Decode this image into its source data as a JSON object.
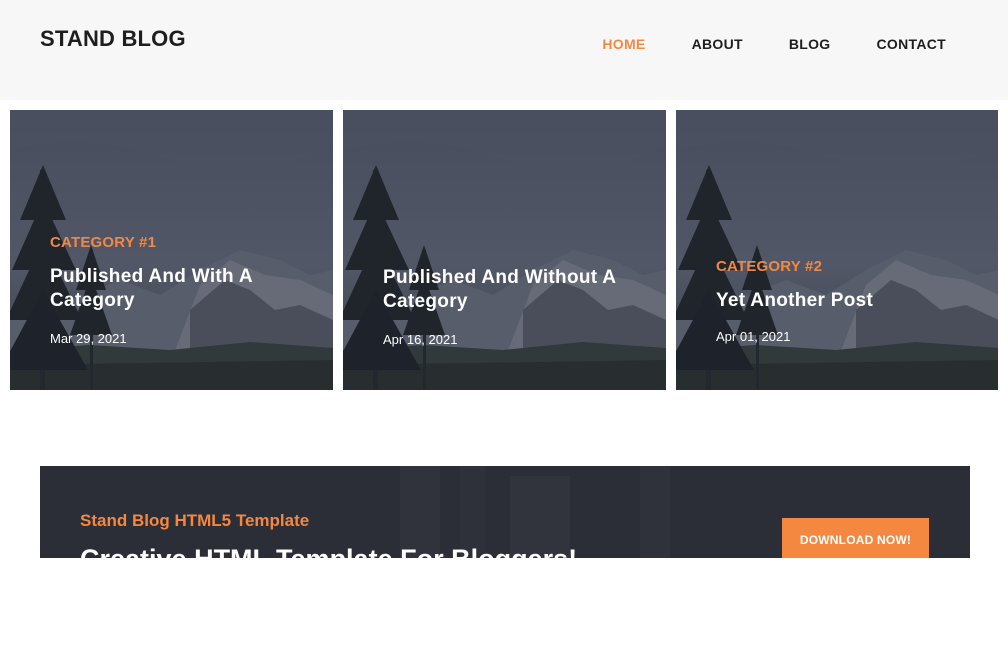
{
  "header": {
    "logo": "STAND BLOG",
    "nav": [
      {
        "label": "HOME",
        "active": true
      },
      {
        "label": "ABOUT",
        "active": false
      },
      {
        "label": "BLOG",
        "active": false
      },
      {
        "label": "CONTACT",
        "active": false
      }
    ]
  },
  "banners": [
    {
      "category": "CATEGORY #1",
      "title": "Published And With A Category",
      "date": "Mar 29, 2021"
    },
    {
      "category": "",
      "title": "Published And Without A Category",
      "date": "Apr 16, 2021"
    },
    {
      "category": "CATEGORY #2",
      "title": "Yet Another Post",
      "date": "Apr 01, 2021"
    }
  ],
  "cta": {
    "subtitle": "Stand Blog HTML5 Template",
    "title": "Creative HTML Template For Bloggers!",
    "button_label": "DOWNLOAD NOW!"
  },
  "colors": {
    "accent": "#f48840",
    "dark": "#2b2e37",
    "header_bg": "#f7f7f7"
  }
}
